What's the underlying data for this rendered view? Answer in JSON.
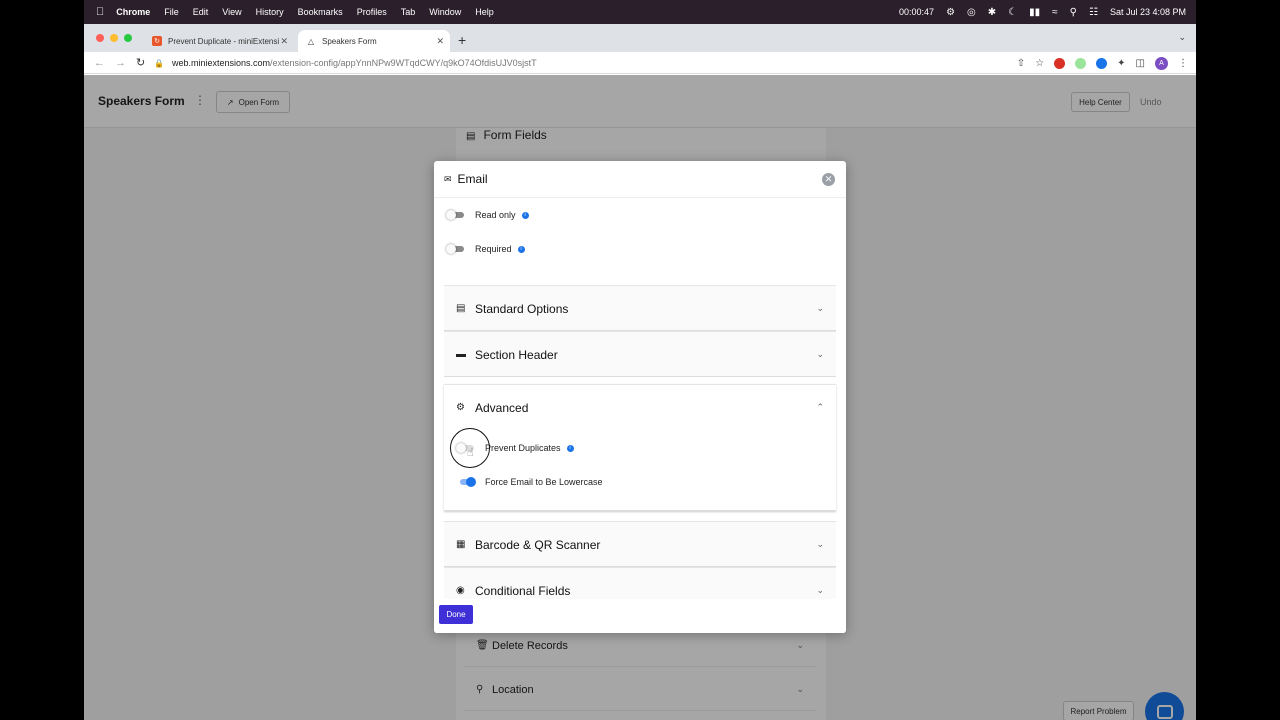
{
  "menubar": {
    "app": "Chrome",
    "items": [
      "File",
      "Edit",
      "View",
      "History",
      "Bookmarks",
      "Profiles",
      "Tab",
      "Window",
      "Help"
    ],
    "timer": "00:00:47",
    "datetime": "Sat Jul 23  4:08 PM"
  },
  "browser": {
    "tabs": [
      {
        "title": "Prevent Duplicate - miniExtensi"
      },
      {
        "title": "Speakers Form"
      }
    ],
    "url_host": "web.miniextensions.com",
    "url_path": "/extension-config/appYnnNPw9WTqdCWY/q9kO74OfdisUJV0sjstT",
    "profile_initial": "A"
  },
  "app": {
    "title": "Speakers Form",
    "open_form_label": "Open Form",
    "help_center_label": "Help Center",
    "undo_label": "Undo",
    "form_fields_label": "Form Fields",
    "bg_sections": [
      {
        "label": "Delete Records",
        "icon": "trash-icon"
      },
      {
        "label": "Location",
        "icon": "location-pin-icon"
      }
    ],
    "report_problem_label": "Report Problem"
  },
  "modal": {
    "title": "Email",
    "read_only_label": "Read only",
    "required_label": "Required",
    "sections": [
      {
        "label": "Standard Options",
        "icon": "clipboard-icon"
      },
      {
        "label": "Section Header",
        "icon": "header-icon"
      },
      {
        "label": "Advanced",
        "icon": "gear-icon"
      },
      {
        "label": "Barcode & QR Scanner",
        "icon": "qr-code-icon"
      },
      {
        "label": "Conditional Fields",
        "icon": "eye-icon"
      }
    ],
    "prevent_duplicates_label": "Prevent Duplicates",
    "force_lowercase_label": "Force Email to Be Lowercase",
    "read_only_on": false,
    "required_on": false,
    "prevent_duplicates_on": false,
    "force_lowercase_on": true,
    "done_label": "Done"
  },
  "colors": {
    "accent": "#1a73e8",
    "done_button": "#3f2fd6"
  }
}
